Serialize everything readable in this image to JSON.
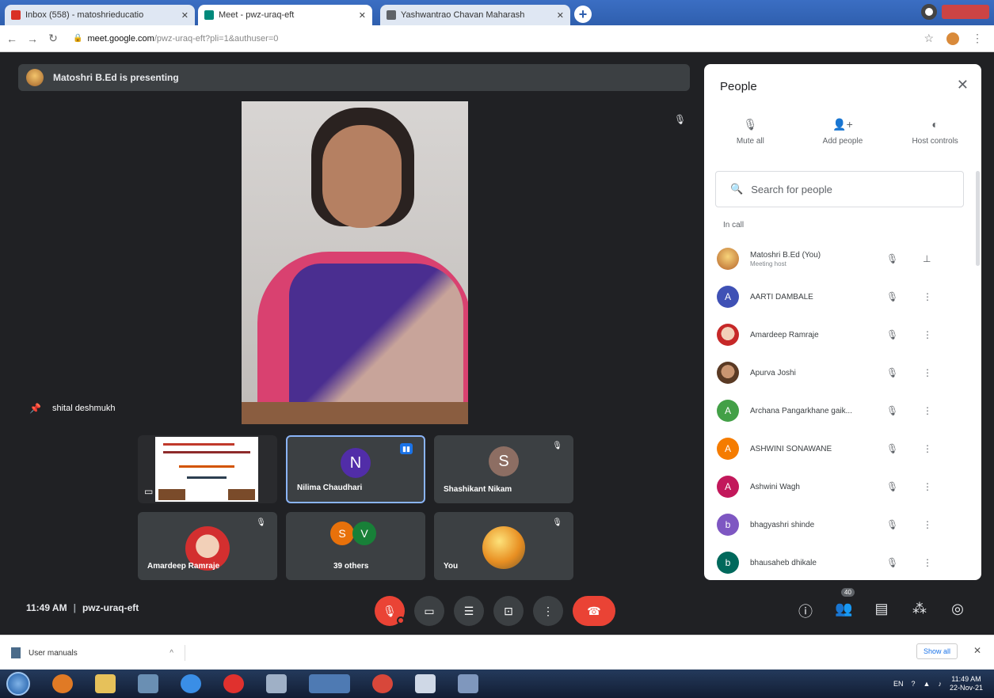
{
  "browser": {
    "tabs": [
      {
        "title": "Inbox (558) - matoshrieducatio",
        "fav_color": "#d93025",
        "active": false
      },
      {
        "title": "Meet - pwz-uraq-eft",
        "fav_color": "#00897b",
        "active": true
      },
      {
        "title": "Yashwantrao Chavan Maharash",
        "fav_color": "#5f6368",
        "active": false
      }
    ],
    "new_tab_label": "+",
    "url_host": "meet.google.com",
    "url_path": "/pwz-uraq-eft?pli=1&authuser=0"
  },
  "meet": {
    "presenting_banner": "Matoshri B.Ed is presenting",
    "main_speaker_name": "shital deshmukh",
    "tiles": [
      {
        "name": "",
        "kind": "presentation"
      },
      {
        "name": "Nilima Chaudhari",
        "initial": "N",
        "color": "#512da8",
        "active": true
      },
      {
        "name": "Shashikant Nikam",
        "initial": "S",
        "color": "#8d6e63"
      },
      {
        "name": "Amardeep Ramraje",
        "kind": "photo"
      },
      {
        "name": "39 others",
        "kind": "others"
      },
      {
        "name": "You",
        "kind": "you"
      }
    ],
    "others_avatars": [
      {
        "initial": "S",
        "color": "#e8710a"
      },
      {
        "initial": "V",
        "color": "#188038"
      }
    ],
    "time": "11:49 AM",
    "separator": "|",
    "meeting_code": "pwz-uraq-eft",
    "people_count": "40"
  },
  "people_panel": {
    "title": "People",
    "actions": [
      {
        "label": "Mute all",
        "icon": "mic-off-icon"
      },
      {
        "label": "Add people",
        "icon": "add-person-icon"
      },
      {
        "label": "Host controls",
        "icon": "toggle-icon"
      }
    ],
    "search_placeholder": "Search for people",
    "section_label": "In call",
    "participants": [
      {
        "name": "Matoshri B.Ed (You)",
        "subtitle": "Meeting host",
        "initial": "",
        "color": "#f0a24b",
        "photo": true,
        "pinned": true
      },
      {
        "name": "AARTI DAMBALE",
        "subtitle": "",
        "initial": "A",
        "color": "#3f51b5"
      },
      {
        "name": "Amardeep Ramraje",
        "subtitle": "",
        "initial": "",
        "color": "#c62828",
        "photo": true
      },
      {
        "name": "Apurva Joshi",
        "subtitle": "",
        "initial": "",
        "color": "#8d5a3b",
        "photo": true
      },
      {
        "name": "Archana Pangarkhane gaik...",
        "subtitle": "",
        "initial": "A",
        "color": "#43a047"
      },
      {
        "name": "ASHWINI SONAWANE",
        "subtitle": "",
        "initial": "A",
        "color": "#f57c00"
      },
      {
        "name": "Ashwini Wagh",
        "subtitle": "",
        "initial": "A",
        "color": "#c2185b"
      },
      {
        "name": "bhagyashri shinde",
        "subtitle": "",
        "initial": "b",
        "color": "#7e57c2"
      },
      {
        "name": "bhausaheb dhikale",
        "subtitle": "",
        "initial": "b",
        "color": "#00695c"
      }
    ]
  },
  "download_shelf": {
    "file_name": "User manuals",
    "show_all": "Show all"
  },
  "taskbar": {
    "lang": "EN",
    "time": "11:49 AM",
    "date": "22-Nov-21"
  }
}
